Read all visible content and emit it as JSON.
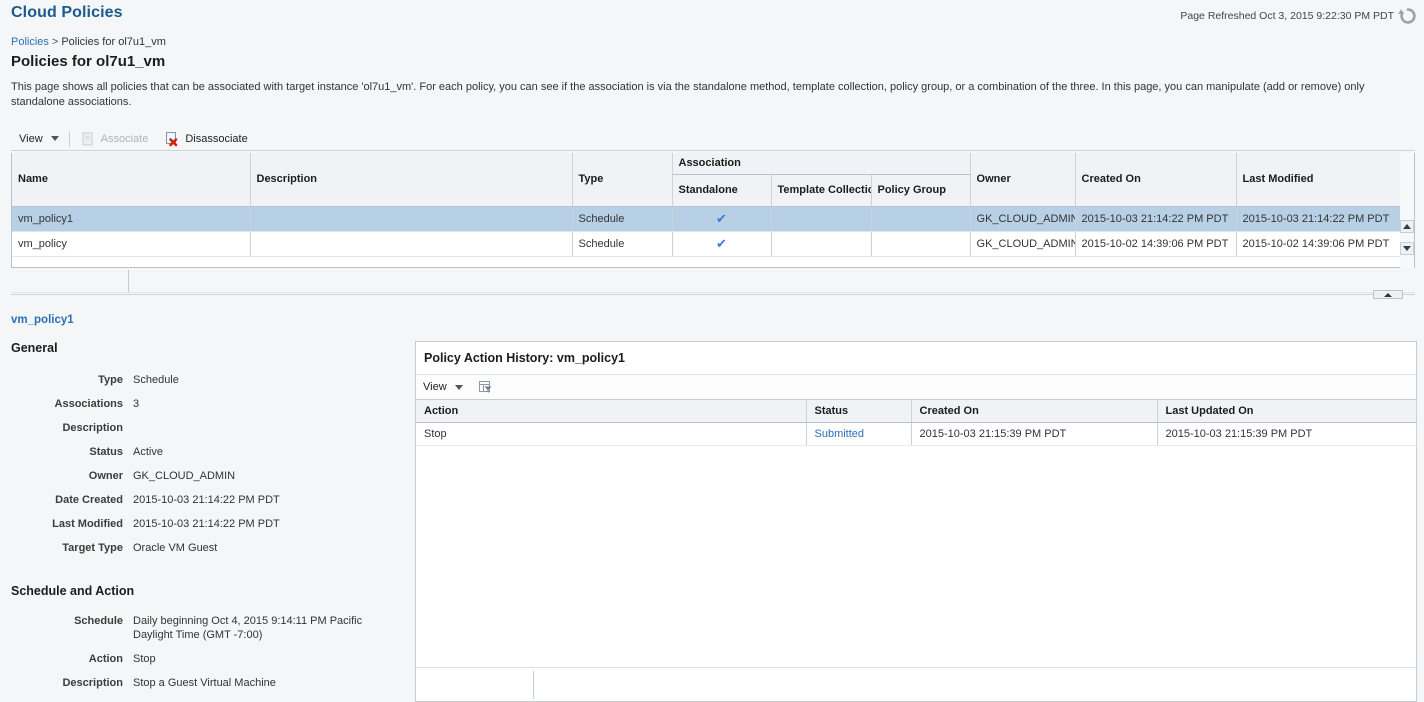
{
  "header": {
    "app_title": "Cloud Policies",
    "refresh_text": "Page Refreshed Oct 3, 2015 9:22:30 PM PDT",
    "refresh_icon": "refresh-icon"
  },
  "breadcrumb": {
    "root": "Policies",
    "separator": ">",
    "current": "Policies for ol7u1_vm"
  },
  "page_title": "Policies for ol7u1_vm",
  "intro": "This page shows all policies that can be associated with target instance 'ol7u1_vm'. For each policy, you can see if the association is via the standalone method, template collection, policy group, or a combination of the three. In this page, you can manipulate (add or remove) only standalone associations.",
  "toolbar": {
    "view_label": "View",
    "associate_label": "Associate",
    "disassociate_label": "Disassociate",
    "associate_icon": "associate-page-icon",
    "disassociate_icon": "page-with-red-x-icon"
  },
  "grid": {
    "group_header": "Association",
    "columns": {
      "name": "Name",
      "description": "Description",
      "type": "Type",
      "standalone": "Standalone",
      "template_collection": "Template Collection",
      "policy_group": "Policy Group",
      "owner": "Owner",
      "created_on": "Created On",
      "last_modified": "Last Modified"
    },
    "check_glyph": "✔",
    "rows": [
      {
        "name": "vm_policy1",
        "description": "",
        "type": "Schedule",
        "standalone": true,
        "template_collection": false,
        "policy_group": false,
        "owner": "GK_CLOUD_ADMIN",
        "created_on": "2015-10-03 21:14:22 PM PDT",
        "last_modified": "2015-10-03 21:14:22 PM PDT",
        "selected": true
      },
      {
        "name": "vm_policy",
        "description": "",
        "type": "Schedule",
        "standalone": true,
        "template_collection": false,
        "policy_group": false,
        "owner": "GK_CLOUD_ADMIN",
        "created_on": "2015-10-02 14:39:06 PM PDT",
        "last_modified": "2015-10-02 14:39:06 PM PDT",
        "selected": false
      }
    ]
  },
  "detail": {
    "policy_link": "vm_policy1",
    "general_heading": "General",
    "general": [
      {
        "label": "Type",
        "value": "Schedule"
      },
      {
        "label": "Associations",
        "value": "3"
      },
      {
        "label": "Description",
        "value": ""
      },
      {
        "label": "Status",
        "value": "Active"
      },
      {
        "label": "Owner",
        "value": "GK_CLOUD_ADMIN"
      },
      {
        "label": "Date Created",
        "value": "2015-10-03 21:14:22 PM PDT"
      },
      {
        "label": "Last Modified",
        "value": "2015-10-03 21:14:22 PM PDT"
      },
      {
        "label": "Target Type",
        "value": "Oracle VM Guest"
      }
    ],
    "schedule_heading": "Schedule and Action",
    "schedule": [
      {
        "label": "Schedule",
        "value": "Daily beginning Oct 4, 2015 9:14:11 PM Pacific Daylight Time (GMT -7:00)"
      },
      {
        "label": "Action",
        "value": "Stop"
      },
      {
        "label": "Description",
        "value": "Stop a Guest Virtual Machine"
      }
    ]
  },
  "history": {
    "title": "Policy Action History: vm_policy1",
    "view_label": "View",
    "filter_icon": "query-by-example-icon",
    "columns": {
      "action": "Action",
      "status": "Status",
      "created_on": "Created On",
      "last_updated_on": "Last Updated On"
    },
    "rows": [
      {
        "action": "Stop",
        "status": "Submitted",
        "created_on": "2015-10-03 21:15:39 PM PDT",
        "last_updated_on": "2015-10-03 21:15:39 PM PDT"
      }
    ]
  },
  "colors": {
    "brand_blue": "#1a5a8e",
    "link_blue": "#2a6ebb",
    "selected_row": "#b8d0e6",
    "check_blue": "#3a7bd5"
  }
}
